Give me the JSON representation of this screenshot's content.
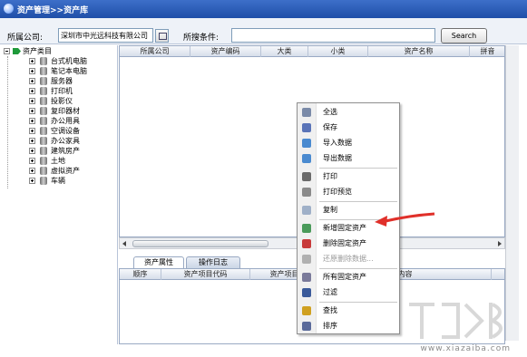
{
  "window": {
    "title": "资产管理>>资产库"
  },
  "toolbar": {
    "company_label": "所属公司:",
    "company_value": "深圳市中光远科技有限公司",
    "search_condition_label": "所搜条件:",
    "search_condition_value": "",
    "search_button": "Search"
  },
  "tree": {
    "root": "资产类目",
    "items": [
      "台式机电脑",
      "笔记本电脑",
      "服务器",
      "打印机",
      "投影仪",
      "复印器材",
      "办公用具",
      "空调设备",
      "办公家具",
      "建筑房产",
      "土地",
      "虚拟资产",
      "车辆"
    ]
  },
  "grid": {
    "columns": [
      "所属公司",
      "资产编码",
      "大类",
      "小类",
      "资产名称",
      "拼音"
    ]
  },
  "tabs": {
    "items": [
      "资产属性",
      "操作日志"
    ],
    "active": "资产属性"
  },
  "detail_grid": {
    "columns": [
      "顺序",
      "资产项目代码",
      "资产项目",
      "内容"
    ]
  },
  "context_menu": {
    "items": [
      {
        "label": "全选",
        "icon": "select-all-icon",
        "enabled": true
      },
      {
        "label": "保存",
        "icon": "save-icon",
        "enabled": true
      },
      {
        "label": "导入数据",
        "icon": "import-icon",
        "enabled": true
      },
      {
        "label": "导出数据",
        "icon": "export-icon",
        "enabled": true
      },
      {
        "label": "打印",
        "icon": "print-icon",
        "enabled": true
      },
      {
        "label": "打印预览",
        "icon": "print-preview-icon",
        "enabled": true
      },
      {
        "label": "复制",
        "icon": "copy-icon",
        "enabled": true
      },
      {
        "label": "新增固定资产",
        "icon": "add-asset-icon",
        "enabled": true
      },
      {
        "label": "删除固定资产",
        "icon": "delete-asset-icon",
        "enabled": true
      },
      {
        "label": "还原删除数据...",
        "icon": "restore-icon",
        "enabled": false
      },
      {
        "label": "所有固定资产",
        "icon": "all-assets-icon",
        "enabled": true
      },
      {
        "label": "过滤",
        "icon": "filter-icon",
        "enabled": true
      },
      {
        "label": "查找",
        "icon": "find-icon",
        "enabled": true
      },
      {
        "label": "排序",
        "icon": "sort-icon",
        "enabled": true
      }
    ]
  },
  "watermark": {
    "text": "www.xiazaiba.com"
  },
  "colors": {
    "title_bar": "#1f4fa8",
    "annotation_arrow": "#e0302a",
    "disabled_text": "#9a9a9a"
  }
}
